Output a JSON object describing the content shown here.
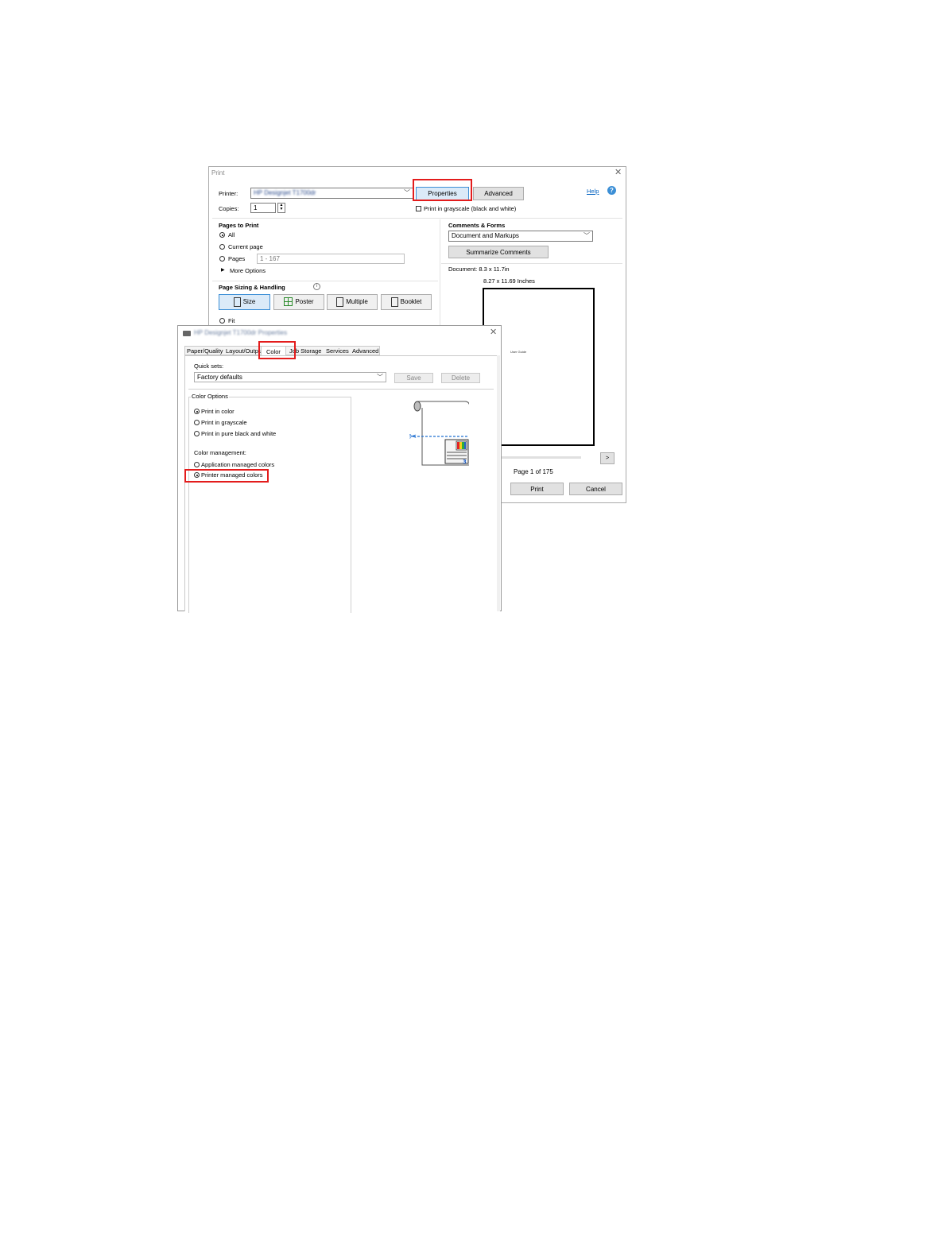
{
  "print_dialog": {
    "title": "Print",
    "printer_label": "Printer:",
    "printer_value": "HP Designjet T1700dr",
    "copies_label": "Copies:",
    "copies_value": "1",
    "properties_label": "Properties",
    "advanced_label": "Advanced",
    "help_label": "Help",
    "grayscale_label": "Print in grayscale (black and white)",
    "pages_to_print": {
      "title": "Pages to Print",
      "all": "All",
      "current_page": "Current page",
      "pages": "Pages",
      "pages_value": "1 - 167",
      "more_options": "More Options"
    },
    "page_sizing": {
      "title": "Page Sizing & Handling",
      "size": "Size",
      "poster": "Poster",
      "multiple": "Multiple",
      "booklet": "Booklet",
      "fit": "Fit"
    },
    "comments_forms": {
      "title": "Comments & Forms",
      "selected": "Document and Markups",
      "summarize": "Summarize Comments"
    },
    "preview": {
      "document_size": "Document: 8.3 x 11.7in",
      "page_dimensions": "8.27 x 11.69 Inches",
      "page_text": "User Guide",
      "next": ">",
      "page_indicator": "Page 1 of 175"
    },
    "print_label": "Print",
    "cancel_label": "Cancel"
  },
  "properties_dialog": {
    "title": "HP Designjet T1700dr Properties",
    "tabs": [
      "Paper/Quality",
      "Layout/Output",
      "Color",
      "Job Storage",
      "Services",
      "Advanced"
    ],
    "active_tab": "Color",
    "quick_sets_label": "Quick sets:",
    "quick_sets_value": "Factory defaults",
    "save_label": "Save",
    "delete_label": "Delete",
    "color_options": {
      "title": "Color Options",
      "print_in_color": "Print in color",
      "print_in_grayscale": "Print in grayscale",
      "print_pure_bw": "Print in pure black and white",
      "management_label": "Color management:",
      "application_managed": "Application managed colors",
      "printer_managed": "Printer managed colors"
    }
  },
  "colors": {
    "highlight": "#e31c1c",
    "link": "#0563c1",
    "help_icon": "#3c8fd6",
    "scissors_line": "#1f6fd1"
  }
}
